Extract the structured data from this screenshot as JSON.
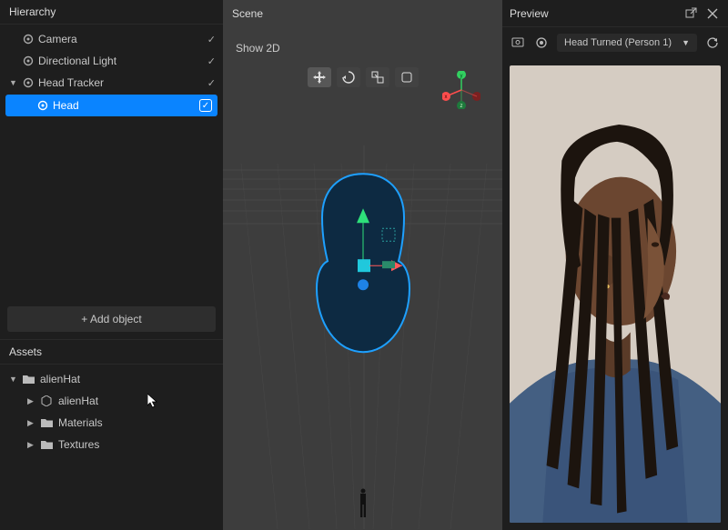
{
  "panels": {
    "hierarchy_title": "Hierarchy",
    "scene_title": "Scene",
    "preview_title": "Preview",
    "assets_title": "Assets"
  },
  "hierarchy": {
    "items": [
      {
        "label": "Camera",
        "level": 0,
        "expandable": false,
        "icon": "object"
      },
      {
        "label": "Directional Light",
        "level": 0,
        "expandable": false,
        "icon": "object"
      },
      {
        "label": "Head Tracker",
        "level": 0,
        "expandable": true,
        "expanded": true,
        "icon": "object"
      },
      {
        "label": "Head",
        "level": 1,
        "expandable": false,
        "icon": "object",
        "selected": true
      }
    ],
    "add_button": "+ Add object"
  },
  "assets": {
    "items": [
      {
        "label": "alienHat",
        "level": 0,
        "icon": "folder",
        "expanded": true
      },
      {
        "label": "alienHat",
        "level": 1,
        "icon": "object"
      },
      {
        "label": "Materials",
        "level": 1,
        "icon": "folder"
      },
      {
        "label": "Textures",
        "level": 1,
        "icon": "folder"
      }
    ]
  },
  "scene": {
    "show2d": "Show 2D",
    "tools": [
      "move",
      "rotate",
      "scale",
      "fit"
    ],
    "axes": {
      "x": "x",
      "y": "y",
      "z": "z"
    }
  },
  "preview": {
    "dropdown_selected": "Head Turned (Person 1)",
    "icons": [
      "popout",
      "close",
      "source",
      "record",
      "refresh"
    ]
  },
  "colors": {
    "accent": "#0a84ff",
    "bg_dark": "#1e1e1e",
    "bg_mid": "#3d3d3d"
  }
}
